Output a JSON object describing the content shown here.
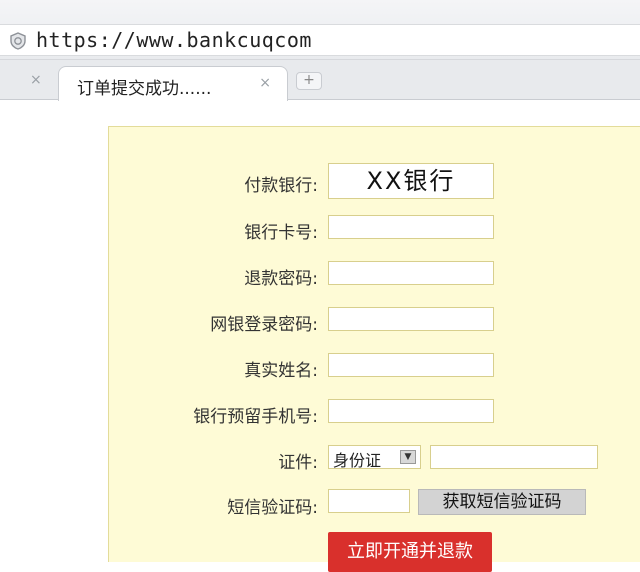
{
  "browser": {
    "url": "https://www.bankcuqcom",
    "tab_title": "订单提交成功......",
    "tab_close": "×",
    "new_tab": "+"
  },
  "form": {
    "payment_bank_label": "付款银行:",
    "payment_bank_value": "XX银行",
    "card_number_label": "银行卡号:",
    "refund_password_label": "退款密码:",
    "online_banking_password_label": "网银登录密码:",
    "real_name_label": "真实姓名:",
    "reserved_phone_label": "银行预留手机号:",
    "id_label": "证件:",
    "id_type_selected": "身份证",
    "sms_code_label": "短信验证码:",
    "get_sms_code_button": "获取短信验证码",
    "submit_button": "立即开通并退款"
  }
}
